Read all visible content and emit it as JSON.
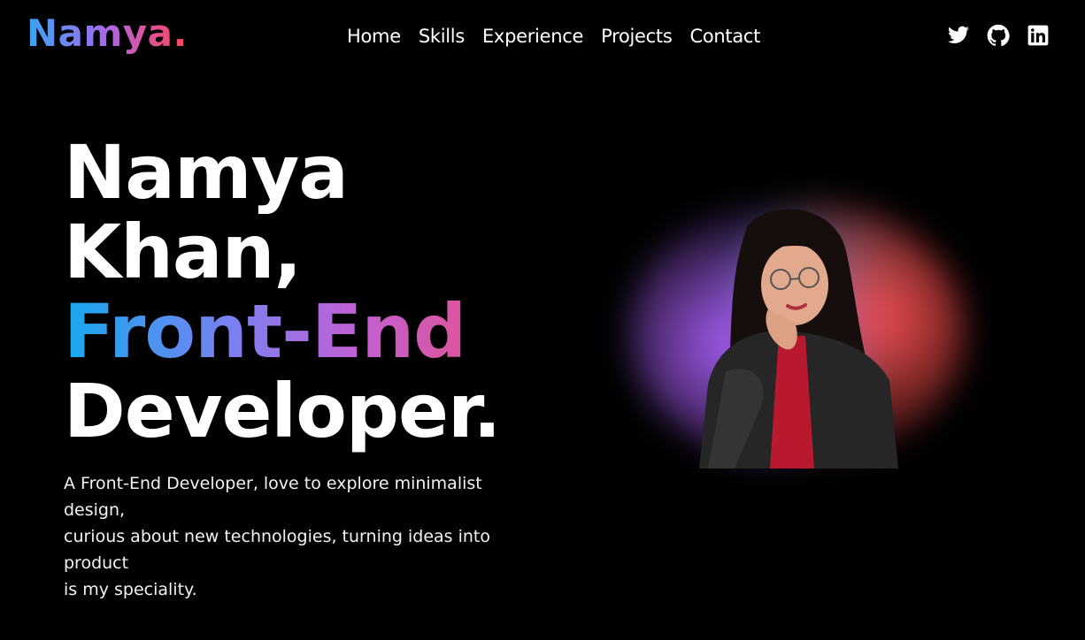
{
  "brand": {
    "logo": "Namya."
  },
  "nav": {
    "items": [
      "Home",
      "Skills",
      "Experience",
      "Projects",
      "Contact"
    ]
  },
  "socials": [
    {
      "icon": "twitter-icon"
    },
    {
      "icon": "github-icon"
    },
    {
      "icon": "linkedin-icon"
    }
  ],
  "hero": {
    "line1": "Namya",
    "line2": "Khan,",
    "line3": "Front-End",
    "line4": "Developer.",
    "intro": [
      "A Front-End Developer, love to explore minimalist",
      "design,",
      "curious about new technologies, turning ideas into",
      "product",
      "is my speciality."
    ]
  },
  "colors": {
    "background": "#000000",
    "gradient_start": "#16a8ef",
    "gradient_mid": "#a46cf0",
    "gradient_end": "#f24c6a"
  }
}
